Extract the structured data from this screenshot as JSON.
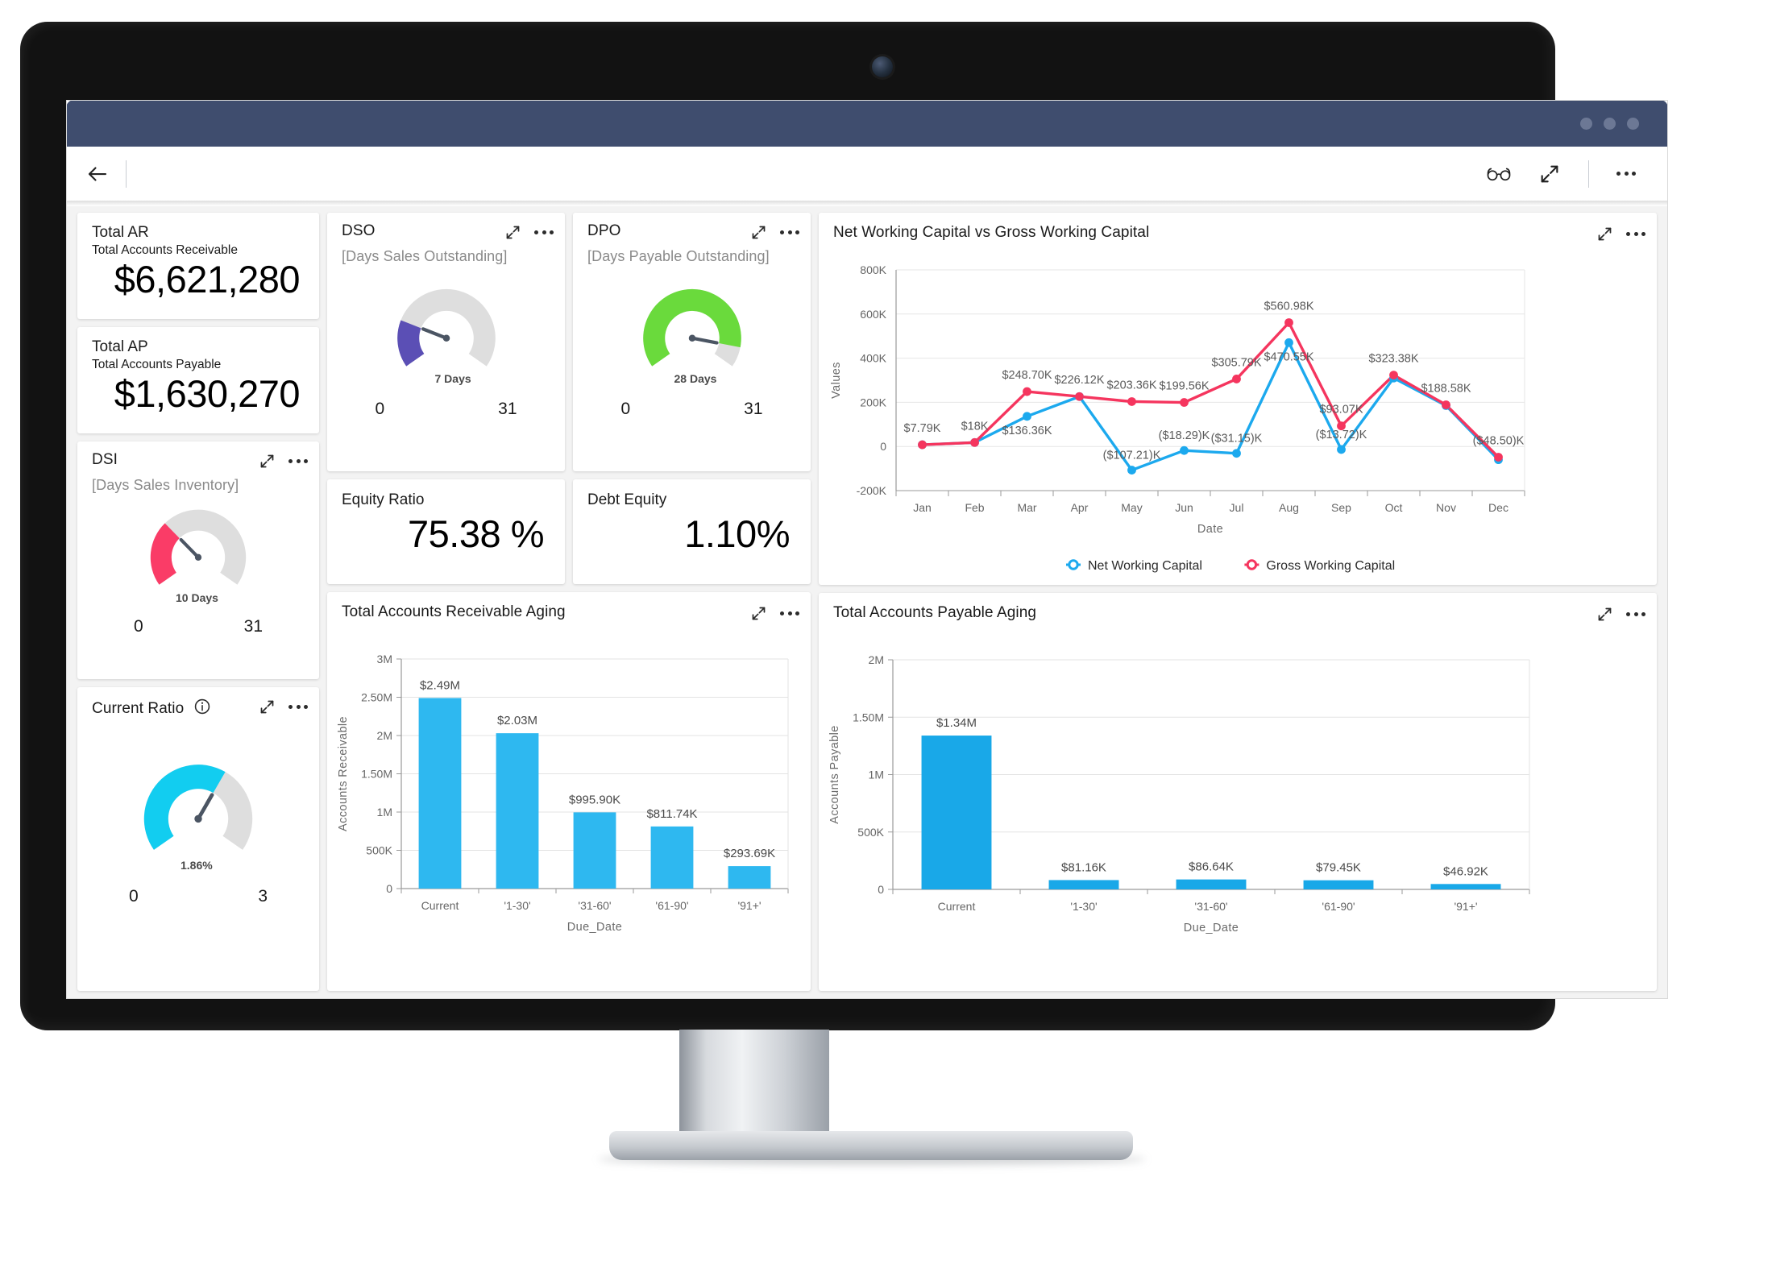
{
  "window": {
    "titlebar_dots": 3
  },
  "toolbar": {
    "back_icon": "arrow-left-icon",
    "reading_view_icon": "glasses-icon",
    "fullscreen_icon": "expand-icon",
    "more_icon": "more-options-icon"
  },
  "cards": {
    "total_ar": {
      "title": "Total AR",
      "subtitle": "Total Accounts Receivable",
      "value": "$6,621,280"
    },
    "total_ap": {
      "title": "Total AP",
      "subtitle": "Total Accounts Payable",
      "value": "$1,630,270"
    },
    "dsi": {
      "title": "DSI",
      "subtitle": "[Days Sales Inventory]",
      "gauge": {
        "value_label": "10 Days",
        "min_label": "0",
        "max_label": "31",
        "min": 0,
        "max": 31,
        "value": 10,
        "color": "#FA3C67",
        "track": "#DEDEDE"
      }
    },
    "current_ratio": {
      "title": "Current Ratio",
      "info_icon": "info-icon",
      "gauge": {
        "value_label": "1.86%",
        "min_label": "0",
        "max_label": "3",
        "min": 0,
        "max": 3,
        "value": 1.86,
        "color": "#12CDF0",
        "track": "#DEDEDE"
      }
    },
    "dso": {
      "title": "DSO",
      "subtitle": "[Days Sales Outstanding]",
      "gauge": {
        "value_label": "7 Days",
        "min_label": "0",
        "max_label": "31",
        "min": 0,
        "max": 31,
        "value": 7,
        "color": "#5B4FB5",
        "track": "#DEDEDE"
      }
    },
    "dpo": {
      "title": "DPO",
      "subtitle": "[Days Payable Outstanding]",
      "gauge": {
        "value_label": "28 Days",
        "min_label": "0",
        "max_label": "31",
        "min": 0,
        "max": 31,
        "value": 28,
        "color": "#6ADA3C",
        "track": "#DEDEDE"
      }
    },
    "equity_ratio": {
      "title": "Equity Ratio",
      "value": "75.38 %"
    },
    "debt_equity": {
      "title": "Debt Equity",
      "value": "1.10%"
    },
    "nwc_vs_gwc": {
      "title": "Net Working Capital vs Gross Working Capital"
    },
    "ar_aging": {
      "title": "Total Accounts Receivable Aging"
    },
    "ap_aging": {
      "title": "Total Accounts Payable Aging"
    }
  },
  "chart_data": [
    {
      "id": "nwc_vs_gwc",
      "type": "line",
      "title": "Net Working Capital vs Gross Working Capital",
      "xlabel": "Date",
      "ylabel": "Values",
      "grid": true,
      "legend_position": "bottom",
      "ylim": [
        -200000,
        800000
      ],
      "ytick_labels": [
        "800K",
        "600K",
        "400K",
        "200K",
        "0",
        "-200K"
      ],
      "ytick_values": [
        800000,
        600000,
        400000,
        200000,
        0,
        -200000
      ],
      "categories": [
        "Jan",
        "Feb",
        "Mar",
        "Apr",
        "May",
        "Jun",
        "Jul",
        "Aug",
        "Sep",
        "Oct",
        "Nov",
        "Dec"
      ],
      "series": [
        {
          "name": "Net Working Capital",
          "color": "#1CA9EE",
          "values": [
            7790,
            18000,
            136360,
            226120,
            -107210,
            -18290,
            -31150,
            470550,
            -13720,
            310000,
            185000,
            -60000
          ],
          "labels": [
            "",
            "",
            "$136.36K",
            "",
            "($107.21)K",
            "($18.29)K",
            "($31.15)K",
            "$470.55K",
            "($13.72)K",
            "",
            "",
            ""
          ]
        },
        {
          "name": "Gross Working Capital",
          "color": "#F5355E",
          "values": [
            7790,
            18000,
            248700,
            226120,
            203360,
            199560,
            305790,
            560980,
            93070,
            323380,
            188580,
            -48500
          ],
          "labels": [
            "$7.79K",
            "$18K",
            "$248.70K",
            "$226.12K",
            "$203.36K",
            "$199.56K",
            "$305.79K",
            "$560.98K",
            "$93.07K",
            "$323.38K",
            "$188.58K",
            "($48.50)K"
          ]
        }
      ]
    },
    {
      "id": "ar_aging",
      "type": "bar",
      "title": "Total Accounts Receivable Aging",
      "xlabel": "Due_Date",
      "ylabel": "Accounts Receivable",
      "grid": true,
      "ylim": [
        0,
        3000000
      ],
      "ytick_labels": [
        "3M",
        "2.50M",
        "2M",
        "1.50M",
        "1M",
        "500K",
        "0"
      ],
      "ytick_values": [
        3000000,
        2500000,
        2000000,
        1500000,
        1000000,
        500000,
        0
      ],
      "categories": [
        "Current",
        "'1-30'",
        "'31-60'",
        "'61-90'",
        "'91+'"
      ],
      "values": [
        2490000,
        2030000,
        995900,
        811740,
        293690
      ],
      "labels": [
        "$2.49M",
        "$2.03M",
        "$995.90K",
        "$811.74K",
        "$293.69K"
      ],
      "bar_color": "#2EB8F0"
    },
    {
      "id": "ap_aging",
      "type": "bar",
      "title": "Total Accounts Payable Aging",
      "xlabel": "Due_Date",
      "ylabel": "Accounts Payable",
      "grid": true,
      "ylim": [
        0,
        2000000
      ],
      "ytick_labels": [
        "2M",
        "1.50M",
        "1M",
        "500K",
        "0"
      ],
      "ytick_values": [
        2000000,
        1500000,
        1000000,
        500000,
        0
      ],
      "categories": [
        "Current",
        "'1-30'",
        "'31-60'",
        "'61-90'",
        "'91+'"
      ],
      "values": [
        1340000,
        81160,
        86640,
        79450,
        46920
      ],
      "labels": [
        "$1.34M",
        "$81.16K",
        "$86.64K",
        "$79.45K",
        "$46.92K"
      ],
      "bar_color": "#19A8E8"
    }
  ]
}
